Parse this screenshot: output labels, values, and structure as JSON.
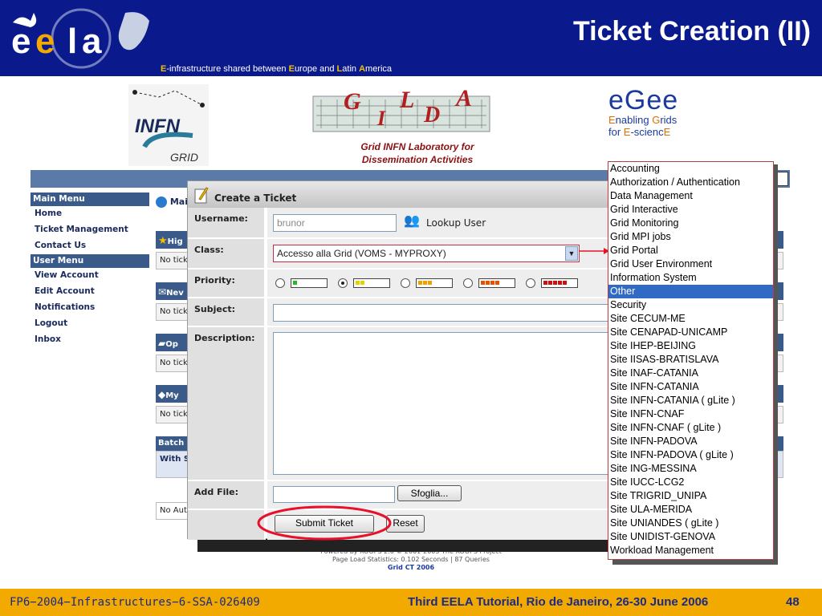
{
  "slide": {
    "title": "Ticket Creation (II)",
    "tagline_parts": [
      "E",
      "-infrastructure shared between ",
      "E",
      "urope and ",
      "L",
      "atin ",
      "A",
      "merica"
    ],
    "footer_left": "FP6−2004−Infrastructures−6-SSA-026409",
    "footer_center": "Third EELA Tutorial, Rio de Janeiro, 26-30 June 2006",
    "page_number": "48",
    "colors": {
      "header_bg": "#0a1a8c",
      "footer_bg": "#f2a900",
      "accent": "#e8102a"
    }
  },
  "banner": {
    "infn_text": "INFN",
    "infn_sub": "GRID",
    "gilda_line1": "Grid INFN Laboratory for",
    "gilda_line2": "Dissemination Activities",
    "egee_word": "eGee",
    "egee_line1": [
      "E",
      "nabling ",
      "G",
      "rids"
    ],
    "egee_line2": [
      "for ",
      "E",
      "-scienc",
      "E"
    ]
  },
  "menu": {
    "main_heading": "Main Menu",
    "main_items": [
      "Home",
      "Ticket Management",
      "Contact Us"
    ],
    "user_heading": "User Menu",
    "user_items": [
      "View Account",
      "Edit Account",
      "Notifications",
      "Logout",
      "Inbox"
    ]
  },
  "main": {
    "title_fragment": "Mai",
    "blocks": [
      {
        "head": "Hig",
        "body": "No tick",
        "icon": "star-icon"
      },
      {
        "head": "Nev",
        "body": "No tick",
        "icon": "new-ticket-icon"
      },
      {
        "head": "Op",
        "body": "No tick",
        "icon": "open-folder-icon"
      },
      {
        "head": "My",
        "body": "No tick",
        "icon": "my-tickets-icon"
      }
    ],
    "batch_head": "Batch",
    "batch_body": "With S",
    "no_auto": "No Aut"
  },
  "dialog": {
    "title": "Create a Ticket",
    "username_label": "Username:",
    "username_value": "brunor",
    "lookup_label": "Lookup User",
    "class_label": "Class:",
    "class_value": "Accesso alla Grid (VOMS - MYPROXY)",
    "priority_label": "Priority:",
    "priority_options": [
      {
        "dots": 1,
        "color": "#22bb22",
        "selected": false
      },
      {
        "dots": 2,
        "color": "#e6d000",
        "selected": true
      },
      {
        "dots": 3,
        "color": "#f0a000",
        "selected": false
      },
      {
        "dots": 4,
        "color": "#e85000",
        "selected": false
      },
      {
        "dots": 5,
        "color": "#cc1010",
        "selected": false
      }
    ],
    "subject_label": "Subject:",
    "description_label": "Description:",
    "add_file_label": "Add File:",
    "browse_label": "Sfoglia...",
    "submit_label": "Submit Ticket",
    "reset_label": "Reset"
  },
  "class_dropdown": {
    "selected_index": 9,
    "options": [
      "Accounting",
      "Authorization / Authentication",
      "Data Management",
      "Grid Interactive",
      "Grid Monitoring",
      "Grid MPI jobs",
      "Grid Portal",
      "Grid User Environment",
      "Information System",
      "Other",
      "Security",
      "Site CECUM-ME",
      "Site CENAPAD-UNICAMP",
      "Site IHEP-BEIJING",
      "Site IISAS-BRATISLAVA",
      "Site INAF-CATANIA",
      "Site INFN-CATANIA",
      "Site INFN-CATANIA ( gLite )",
      "Site INFN-CNAF",
      "Site INFN-CNAF ( gLite )",
      "Site INFN-PADOVA",
      "Site INFN-PADOVA ( gLite )",
      "Site ING-MESSINA",
      "Site IUCC-LCG2",
      "Site TRIGRID_UNIPA",
      "Site ULA-MERIDA",
      "Site UNIANDES ( gLite )",
      "Site UNIDIST-GENOVA",
      "Workload Management"
    ]
  },
  "xoops_footer": {
    "line1": "Powered by XOOPS 2.0 © 2001-2005 The XOOPS Project",
    "line2": "Page Load Statistics: 0.102 Seconds | 87 Queries",
    "line3": "Grid CT 2006"
  }
}
